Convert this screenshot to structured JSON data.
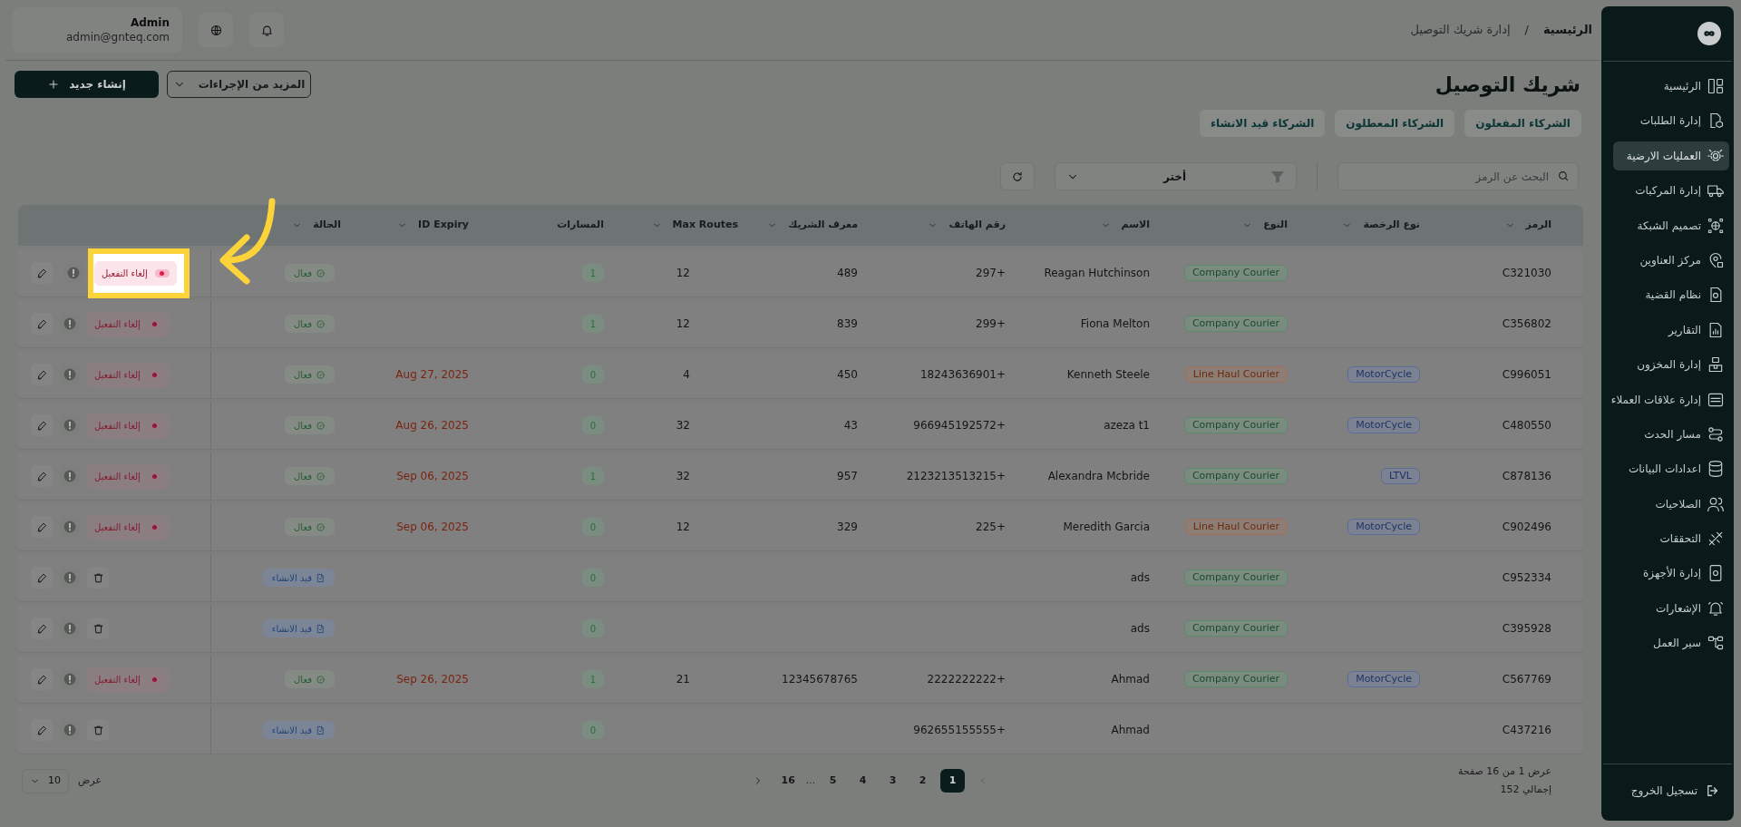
{
  "header": {
    "breadcrumb": [
      {
        "label": "الرئيسية",
        "current": false
      },
      {
        "label": "إدارة شريك التوصيل",
        "current": true
      }
    ],
    "separator": "/",
    "user": {
      "name": "Admin",
      "email": "admin@gnteq.com"
    }
  },
  "page": {
    "title": "شريك التوصيل",
    "actions": [
      {
        "label": "المزيد من الإجراءات",
        "kind": "dropdown"
      },
      {
        "label": "إنشاء جديد",
        "kind": "primary"
      }
    ]
  },
  "tabs": [
    {
      "label": "الشركاء المفعلون"
    },
    {
      "label": "الشركاء المعطلون"
    },
    {
      "label": "الشركاء قيد الانشاء"
    }
  ],
  "filters": {
    "search_placeholder": "البحث عن الرمز",
    "select_value": "أختر"
  },
  "table": {
    "columns": [
      {
        "label": "الرمز",
        "sortable": true
      },
      {
        "label": "نوع الرخصة",
        "sortable": true
      },
      {
        "label": "النوع",
        "sortable": true
      },
      {
        "label": "الاسم",
        "sortable": true
      },
      {
        "label": "رقم الهاتف",
        "sortable": true
      },
      {
        "label": "معرف الشريك",
        "sortable": true
      },
      {
        "label": "Max Routes",
        "sortable": true
      },
      {
        "label": "المسارات",
        "sortable": false
      },
      {
        "label": "ID Expiry",
        "sortable": true
      },
      {
        "label": "الحالة",
        "sortable": true
      }
    ],
    "rows": [
      {
        "code": "C321030",
        "type": {
          "label": "Company Courier",
          "kind": "company"
        },
        "name": "Reagan Hutchinson",
        "phone": "297+",
        "partner_id": "489",
        "max_routes": "12",
        "routes": "1",
        "status": {
          "label": "فعال",
          "kind": "active"
        },
        "action_label": "إلغاء التفعيل",
        "highlighted": true
      },
      {
        "code": "C356802",
        "type": {
          "label": "Company Courier",
          "kind": "company"
        },
        "name": "Fiona Melton",
        "phone": "299+",
        "partner_id": "839",
        "max_routes": "12",
        "routes": "1",
        "status": {
          "label": "فعال",
          "kind": "active"
        },
        "action_label": "إلغاء التفعيل",
        "highlighted": false
      },
      {
        "code": "C996051",
        "license": "MotorCycle",
        "type": {
          "label": "Line Haul Courier",
          "kind": "linehaul"
        },
        "name": "Kenneth Steele",
        "phone": "18243636901+",
        "partner_id": "450",
        "max_routes": "4",
        "routes": "0",
        "expiry": "Aug 27, 2025",
        "status": {
          "label": "فعال",
          "kind": "active"
        },
        "action_label": "إلغاء التفعيل",
        "highlighted": false
      },
      {
        "code": "C480550",
        "license": "MotorCycle",
        "type": {
          "label": "Company Courier",
          "kind": "company"
        },
        "name": "azeza t1",
        "phone": "966945192572+",
        "partner_id": "43",
        "max_routes": "32",
        "routes": "0",
        "expiry": "Aug 26, 2025",
        "status": {
          "label": "فعال",
          "kind": "active"
        },
        "action_label": "إلغاء التفعيل",
        "highlighted": false
      },
      {
        "code": "C878136",
        "license": "LTVL",
        "type": {
          "label": "Company Courier",
          "kind": "company"
        },
        "name": "Alexandra Mcbride",
        "phone": "2123213513215+",
        "partner_id": "957",
        "max_routes": "32",
        "routes": "1",
        "expiry": "Sep 06, 2025",
        "status": {
          "label": "فعال",
          "kind": "active"
        },
        "action_label": "إلغاء التفعيل",
        "highlighted": false
      },
      {
        "code": "C902496",
        "license": "MotorCycle",
        "type": {
          "label": "Line Haul Courier",
          "kind": "linehaul"
        },
        "name": "Meredith Garcia",
        "phone": "225+",
        "partner_id": "329",
        "max_routes": "12",
        "routes": "0",
        "expiry": "Sep 06, 2025",
        "status": {
          "label": "فعال",
          "kind": "active"
        },
        "action_label": "إلغاء التفعيل",
        "highlighted": false
      },
      {
        "code": "C952334",
        "type": {
          "label": "Company Courier",
          "kind": "company"
        },
        "name": "ads",
        "routes": "0",
        "status": {
          "label": "قيد الانشاء",
          "kind": "draft"
        },
        "highlighted": false
      },
      {
        "code": "C395928",
        "type": {
          "label": "Company Courier",
          "kind": "company"
        },
        "name": "ads",
        "routes": "0",
        "status": {
          "label": "قيد الانشاء",
          "kind": "draft"
        },
        "highlighted": false
      },
      {
        "code": "C567769",
        "license": "MotorCycle",
        "type": {
          "label": "Company Courier",
          "kind": "company"
        },
        "name": "Ahmad",
        "phone": "2222222222+",
        "partner_id": "12345678765",
        "max_routes": "21",
        "routes": "1",
        "expiry": "Sep 26, 2025",
        "status": {
          "label": "فعال",
          "kind": "active"
        },
        "action_label": "إلغاء التفعيل",
        "highlighted": false
      },
      {
        "code": "C437216",
        "name": "Ahmad",
        "phone": "962655155555+",
        "routes": "0",
        "status": {
          "label": "قيد الانشاء",
          "kind": "draft"
        },
        "highlighted": false
      }
    ]
  },
  "pagination": {
    "summary": "عرض 1 من 16 صفحة",
    "total": "إجمالي 152",
    "prev_disabled": true,
    "pages": [
      {
        "label": "1",
        "selected": true
      },
      {
        "label": "2",
        "selected": false
      },
      {
        "label": "3",
        "selected": false
      },
      {
        "label": "4",
        "selected": false
      },
      {
        "label": "5",
        "selected": false
      }
    ],
    "ellipsis": "...",
    "last_page": {
      "label": "16",
      "selected": false
    },
    "page_size_label": "عرض",
    "page_size": "10"
  },
  "sidebar": {
    "items": [
      {
        "label": "الرئيسية",
        "selected": false
      },
      {
        "label": "إدارة الطلبات",
        "selected": false
      },
      {
        "label": "العمليات الارضية",
        "selected": true
      },
      {
        "label": "إدارة المركبات",
        "selected": false
      },
      {
        "label": "تصميم الشبكة",
        "selected": false
      },
      {
        "label": "مركز العناوين",
        "selected": false
      },
      {
        "label": "نظام القضية",
        "selected": false
      },
      {
        "label": "التقارير",
        "selected": false
      },
      {
        "label": "إدارة المخزون",
        "selected": false
      },
      {
        "label": "إدارة علاقات العملاء",
        "selected": false
      },
      {
        "label": "مسار الحدث",
        "selected": false
      },
      {
        "label": "اعدادات البيانات",
        "selected": false
      },
      {
        "label": "الصلاحيات",
        "selected": false
      },
      {
        "label": "التحققات",
        "selected": false
      },
      {
        "label": "إدارة الأجهزة",
        "selected": false
      },
      {
        "label": "الإشعارات",
        "selected": false
      },
      {
        "label": "سير العمل",
        "selected": false
      }
    ],
    "logout": "تسجيل الخروج"
  }
}
